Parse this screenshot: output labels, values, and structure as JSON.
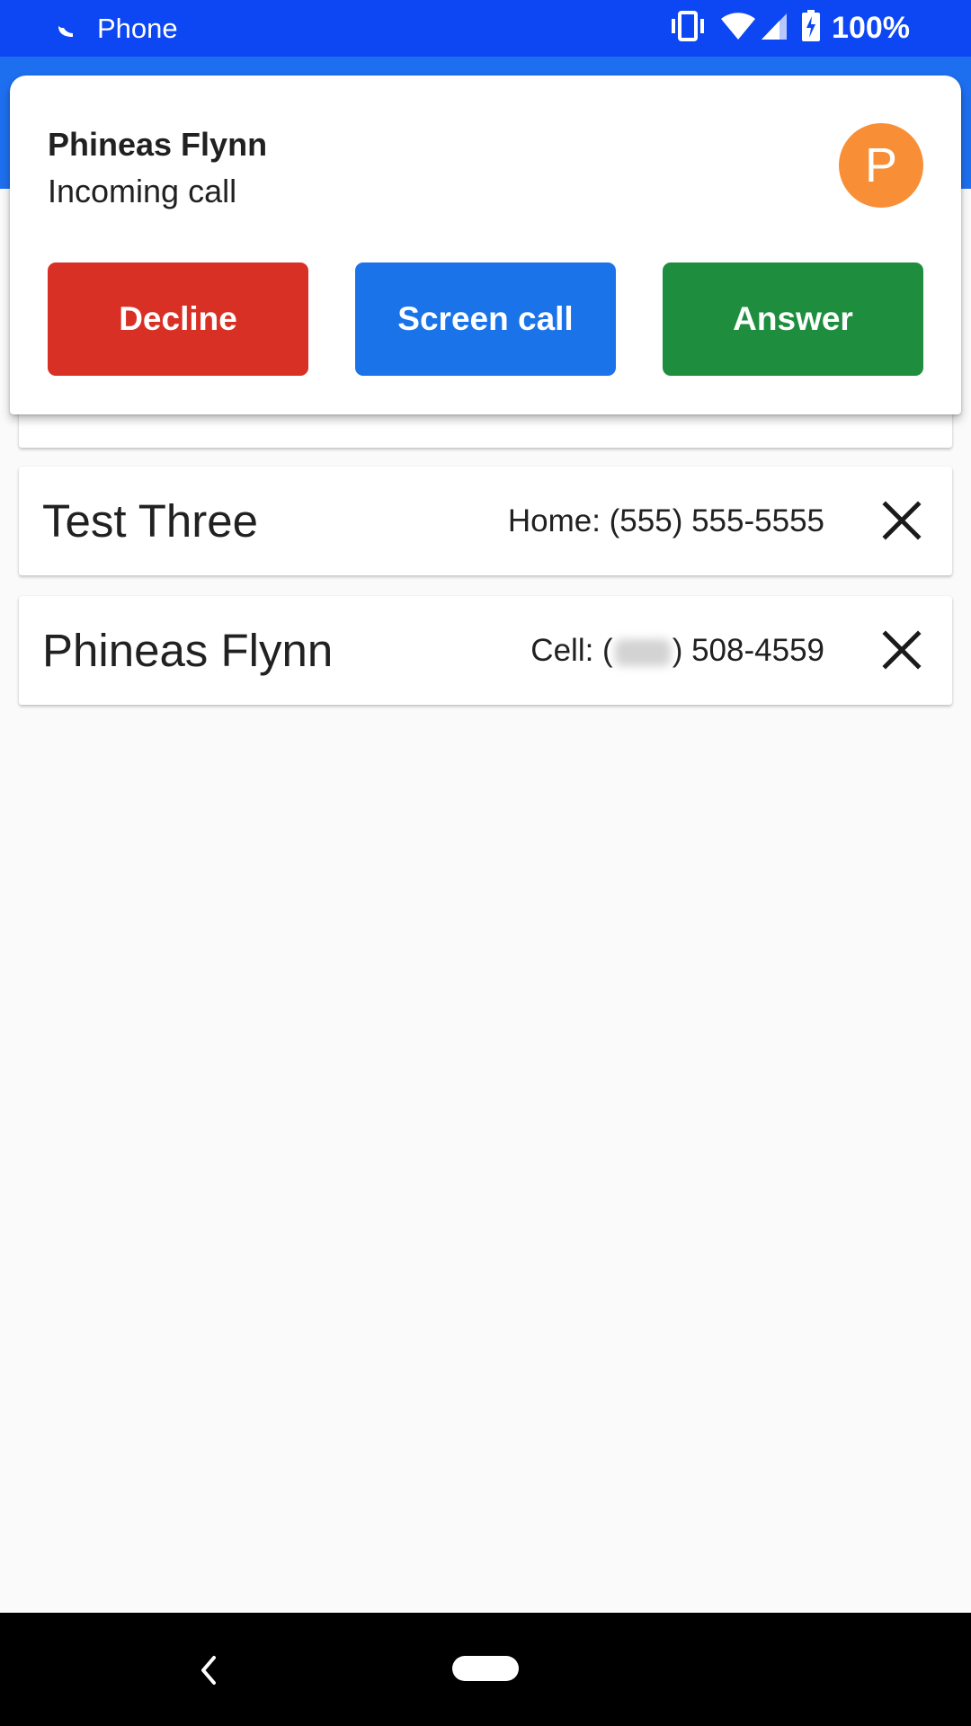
{
  "status_bar": {
    "app_name": "Phone",
    "battery_percent": "100%",
    "icons": [
      "phone-handset-icon",
      "vibrate-icon",
      "wifi-icon",
      "cell-signal-icon",
      "battery-charging-icon"
    ]
  },
  "notification": {
    "caller_name": "Phineas Flynn",
    "status": "Incoming call",
    "avatar_initial": "P",
    "avatar_color": "#f88f36",
    "buttons": {
      "decline": "Decline",
      "screen_call": "Screen call",
      "answer": "Answer"
    },
    "button_colors": {
      "decline": "#d93025",
      "screen_call": "#1a73e8",
      "answer": "#1e8e3e"
    }
  },
  "contacts": [
    {
      "name": "Test Three",
      "phone": "Home: (555) 555-5555",
      "remove_icon": "close-icon"
    },
    {
      "name": "Phineas Flynn",
      "phone_prefix": "Cell: (",
      "phone_suffix": ") 508-4559",
      "remove_icon": "close-icon"
    }
  ],
  "nav_bar": {
    "icons": [
      "back-icon",
      "home-pill-icon"
    ]
  },
  "colors": {
    "status_bar": "#0d47f4",
    "app_bar": "#1e6ff0",
    "background": "#fafafa"
  }
}
